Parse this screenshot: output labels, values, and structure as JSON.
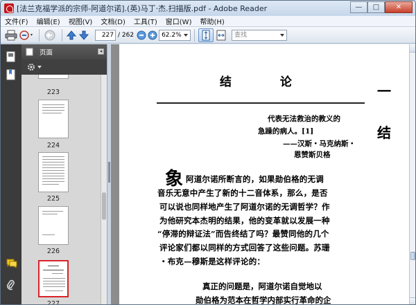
{
  "window": {
    "title": "[法兰克福学派的宗师-阿道尔诺].(英)马丁·杰.扫描版.pdf - Adobe Reader",
    "minimize": "—",
    "maximize": "□",
    "close": "✕"
  },
  "menu": [
    "文件(F)",
    "编辑(E)",
    "视图(V)",
    "文档(D)",
    "工具(T)",
    "窗口(W)",
    "帮助(H)"
  ],
  "toolbar": {
    "current_page": "227",
    "total_pages": "/ 262",
    "zoom": "62.2%",
    "search_placeholder": "查找"
  },
  "sidebar": {
    "panel_title": "页面",
    "thumbnails": [
      {
        "label": "223"
      },
      {
        "label": "224"
      },
      {
        "label": "225"
      },
      {
        "label": "226"
      },
      {
        "label": "227",
        "selected": true
      }
    ]
  },
  "document": {
    "title": "结 论",
    "epigraph": [
      "代表无法救治的教义的",
      "急躁的病人。[1]",
      "——汉斯・马克纳斯・",
      "恩赞斯贝格"
    ],
    "dropcap": "象",
    "body_lines": [
      "阿道尔诺所断言的，如果勋伯格的无调",
      "音乐无意中产生了新的十二音体系，那么，是否",
      "可以说也同样地产生了阿道尔诺的无调哲学？作",
      "为他研究本杰明的结果，他的变革就以发展一种",
      "“停滞的辩证法”而告终结了吗？最赞同他的几个",
      "评论家们都以同样的方式回答了这些问题。苏珊",
      "・布克—穆斯是这样评论的："
    ],
    "block_quote": [
      "真正的问题是，阿道尔诺自觉地以",
      "勋伯格为范本在哲学内部实行革命的企"
    ],
    "edge_glyphs": [
      "一",
      "结"
    ]
  }
}
